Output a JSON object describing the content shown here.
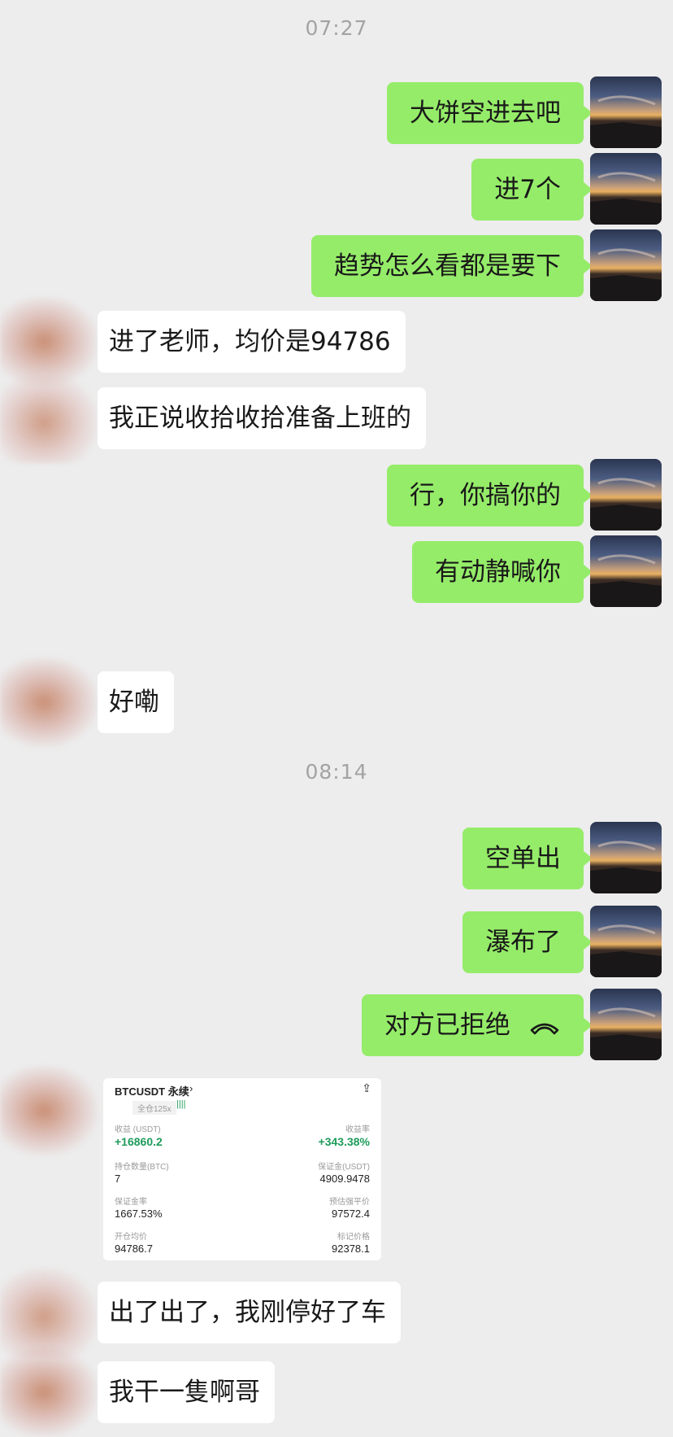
{
  "chat": {
    "timestamps": [
      "07:27",
      "08:14"
    ],
    "messages": [
      {
        "from": "me",
        "text": "大饼空进去吧"
      },
      {
        "from": "me",
        "text": "进7个"
      },
      {
        "from": "me",
        "text": "趋势怎么看都是要下"
      },
      {
        "from": "them",
        "text": "进了老师，均价是94786"
      },
      {
        "from": "them",
        "text": "我正说收拾收拾准备上班的"
      },
      {
        "from": "me",
        "text": "行，你搞你的"
      },
      {
        "from": "me",
        "text": "有动静喊你"
      },
      {
        "from": "them",
        "text": "好嘞"
      },
      {
        "from": "me",
        "text": "空单出"
      },
      {
        "from": "me",
        "text": "瀑布了"
      },
      {
        "from": "me",
        "text": "对方已拒绝",
        "icon": "hangup-phone-icon"
      },
      {
        "from": "them",
        "text": "出了出了，我刚停好了车"
      },
      {
        "from": "them",
        "text": "我干一隻啊哥"
      }
    ],
    "screenshot": {
      "symbol": "BTCUSDT 永续",
      "mode": "全仓125x",
      "pnl_label": "收益 (USDT)",
      "pnl_value": "+16860.2",
      "roi_label": "收益率",
      "roi_value": "+343.38%",
      "qty_label": "持仓数量(BTC)",
      "qty_value": "7",
      "margin_label": "保证金(USDT)",
      "margin_value": "4909.9478",
      "margin_rate_label": "保证金率",
      "margin_rate_value": "1667.53%",
      "liq_label": "预估强平价",
      "liq_value": "97572.4",
      "open_label": "开仓均价",
      "open_value": "94786.7",
      "mark_label": "标记价格",
      "mark_value": "92378.1"
    }
  },
  "colors": {
    "background": "#ededed",
    "my_bubble": "#95ec69",
    "their_bubble": "#ffffff",
    "profit": "#1e9b5a"
  }
}
